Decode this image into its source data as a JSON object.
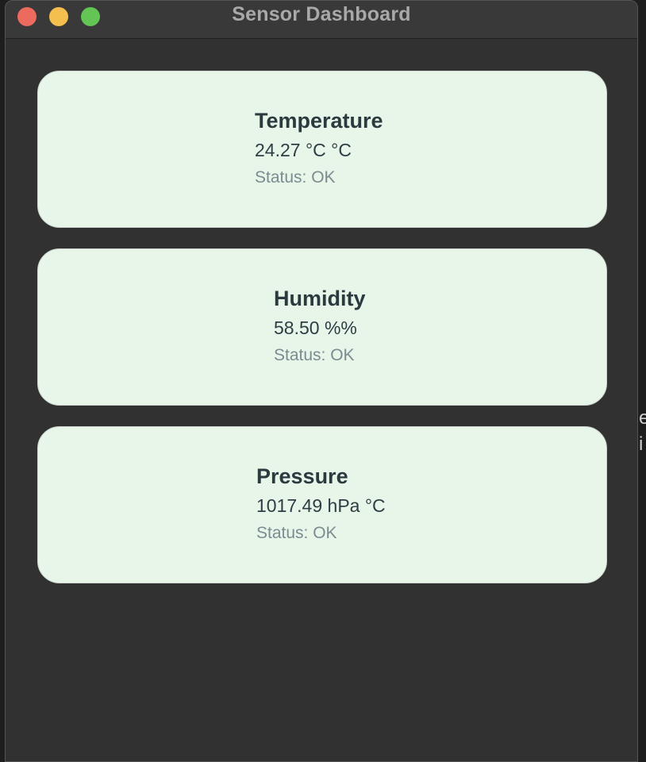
{
  "window": {
    "title": "Sensor Dashboard",
    "colors": {
      "close": "#ed6a5e",
      "minimize": "#f5bf4f",
      "zoom": "#62c554",
      "card_background": "#e8f5e9"
    }
  },
  "sensors": [
    {
      "name": "Temperature",
      "value": "24.27 °C °C",
      "status": "Status: OK"
    },
    {
      "name": "Humidity",
      "value": "58.50 %%",
      "status": "Status: OK"
    },
    {
      "name": "Pressure",
      "value": "1017.49 hPa °C",
      "status": "Status: OK"
    }
  ],
  "background_app": {
    "fragments": [
      "e",
      "i"
    ]
  }
}
